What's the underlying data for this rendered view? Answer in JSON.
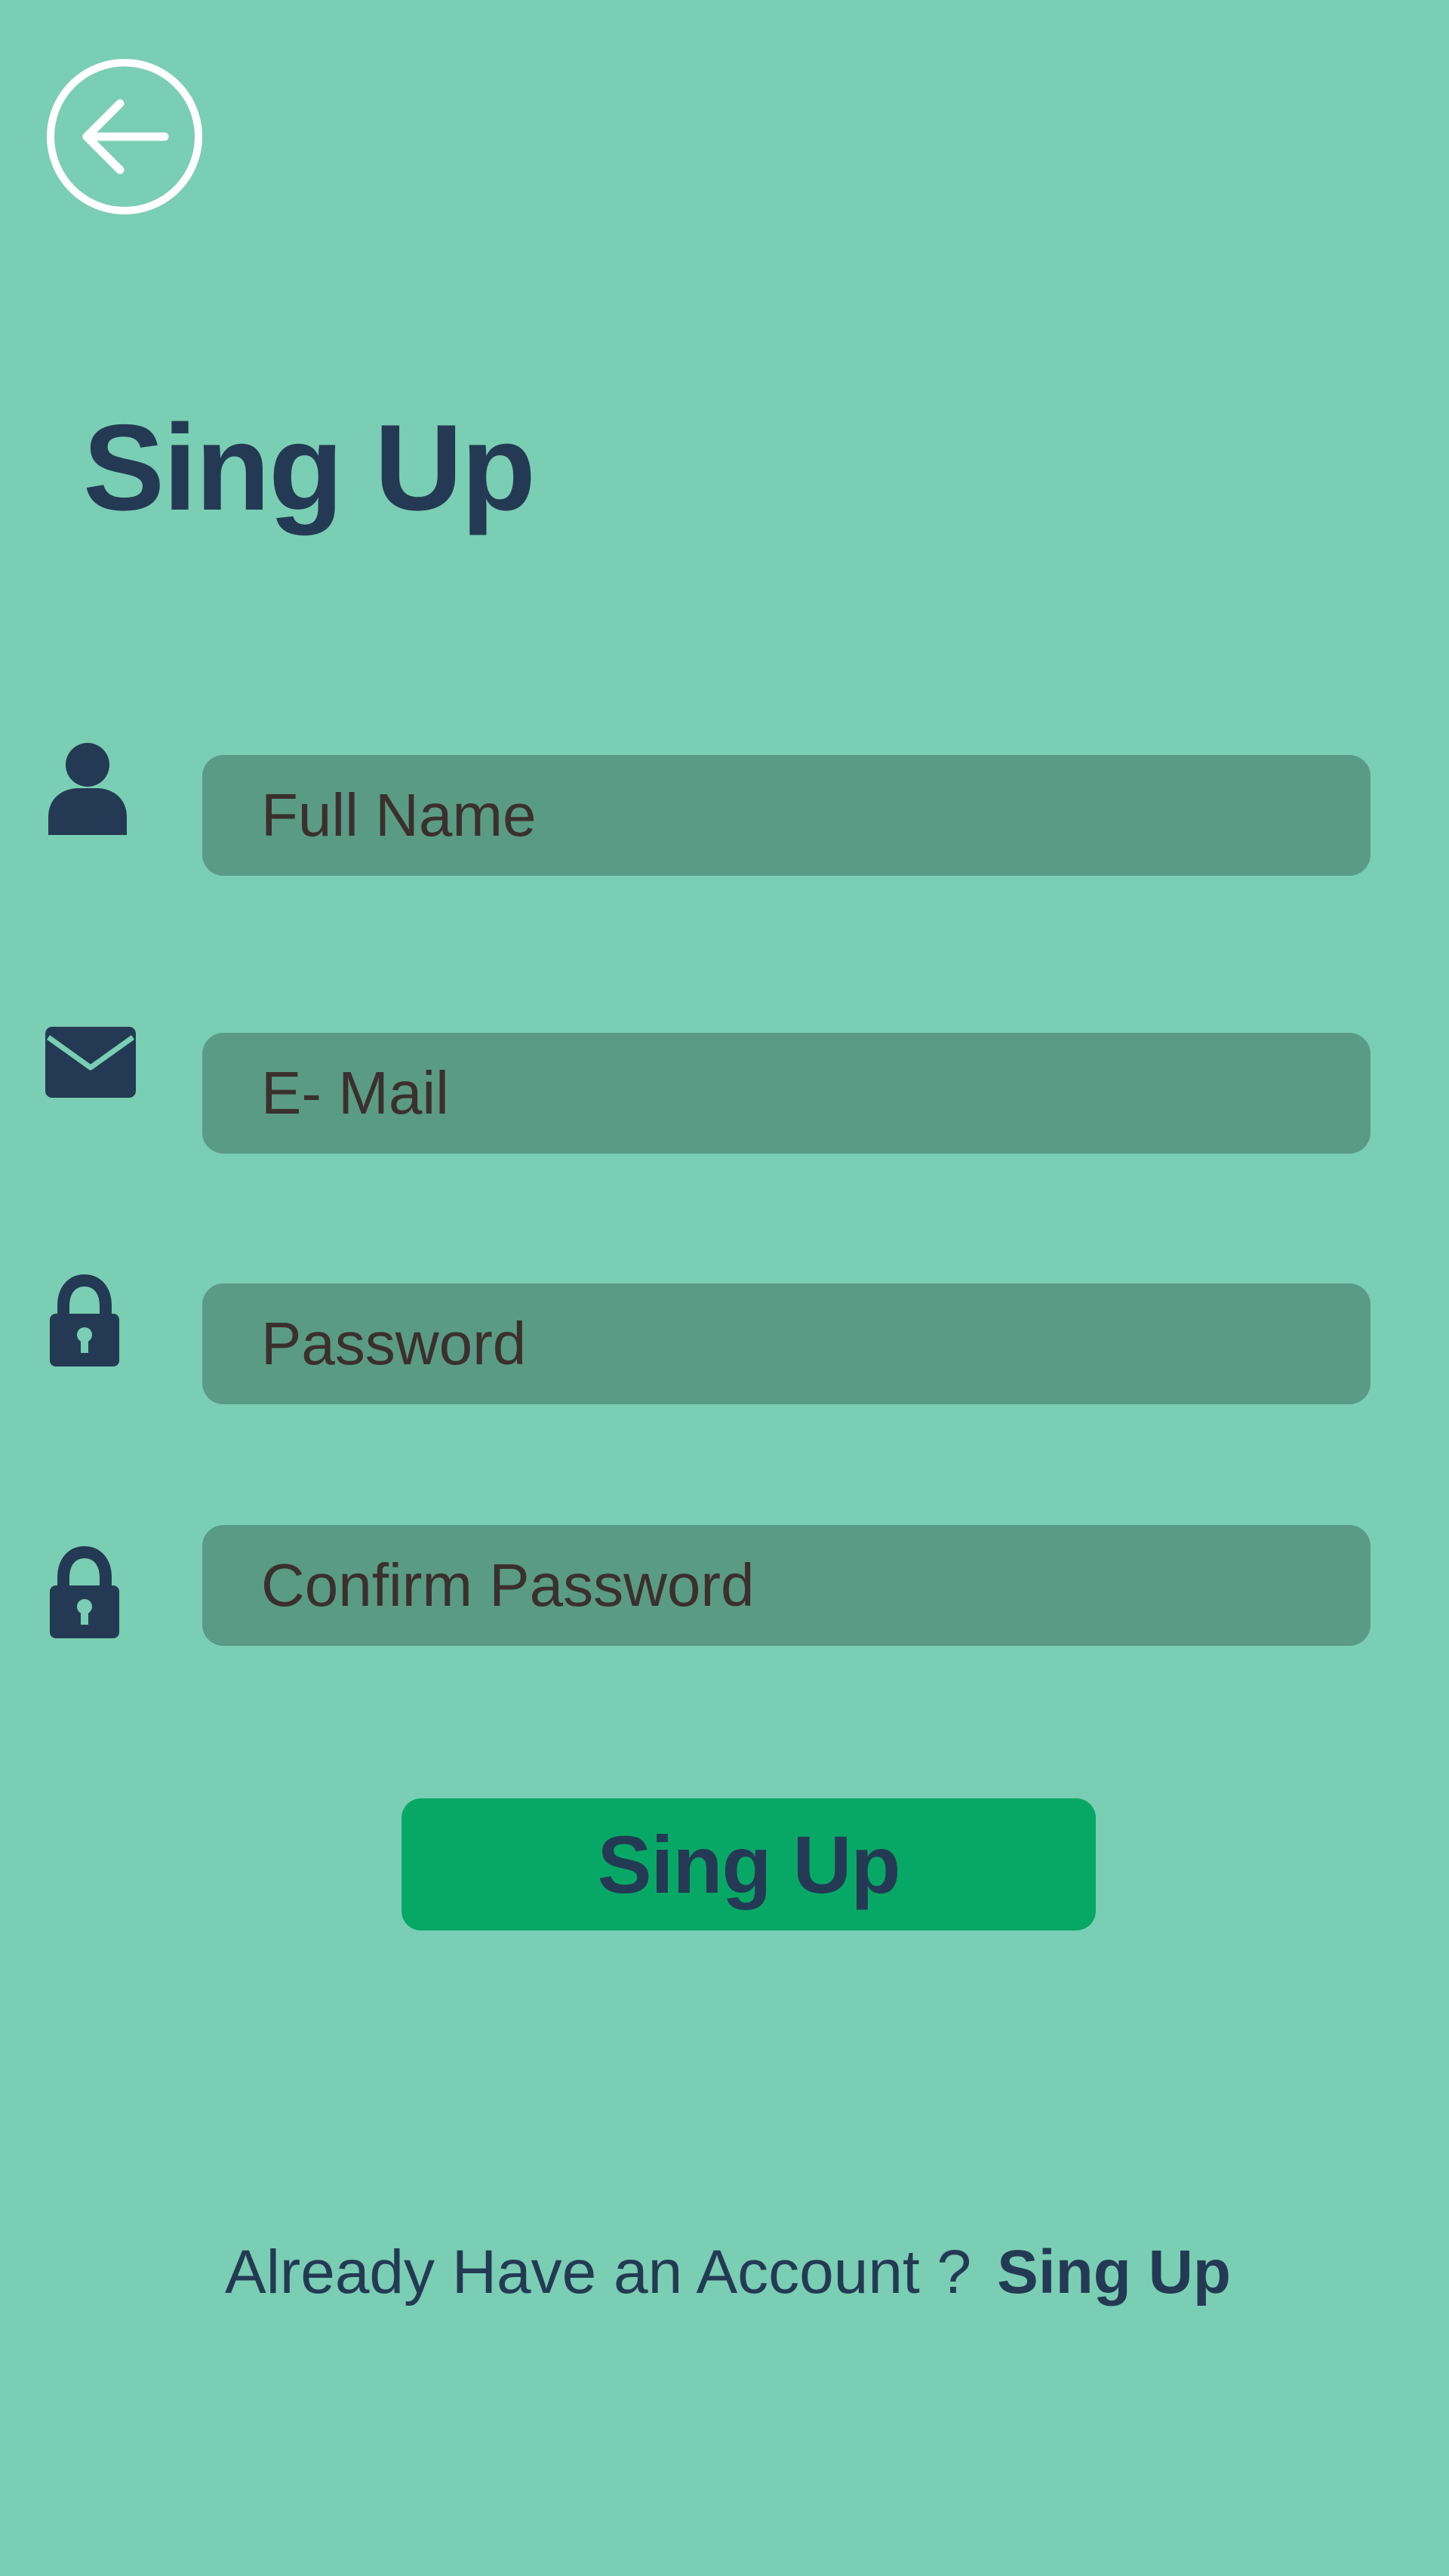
{
  "colors": {
    "background": "#7ACEB3",
    "input_fill": "#5A9B85",
    "button_fill": "#07A866",
    "primary_text": "#243A54",
    "placeholder_text": "#3B2F2F",
    "back_icon": "#FFFFFF"
  },
  "header": {
    "back_icon": "arrow-left-circle-icon"
  },
  "title": "Sing Up",
  "form": {
    "fields": [
      {
        "icon": "person-icon",
        "placeholder": "Full Name"
      },
      {
        "icon": "envelope-icon",
        "placeholder": "E- Mail"
      },
      {
        "icon": "lock-icon",
        "placeholder": "Password"
      },
      {
        "icon": "lock-icon",
        "placeholder": "Confirm Password"
      }
    ],
    "submit_label": "Sing Up"
  },
  "footer": {
    "prompt": "Already Have an Account ?",
    "link_label": "Sing Up"
  }
}
